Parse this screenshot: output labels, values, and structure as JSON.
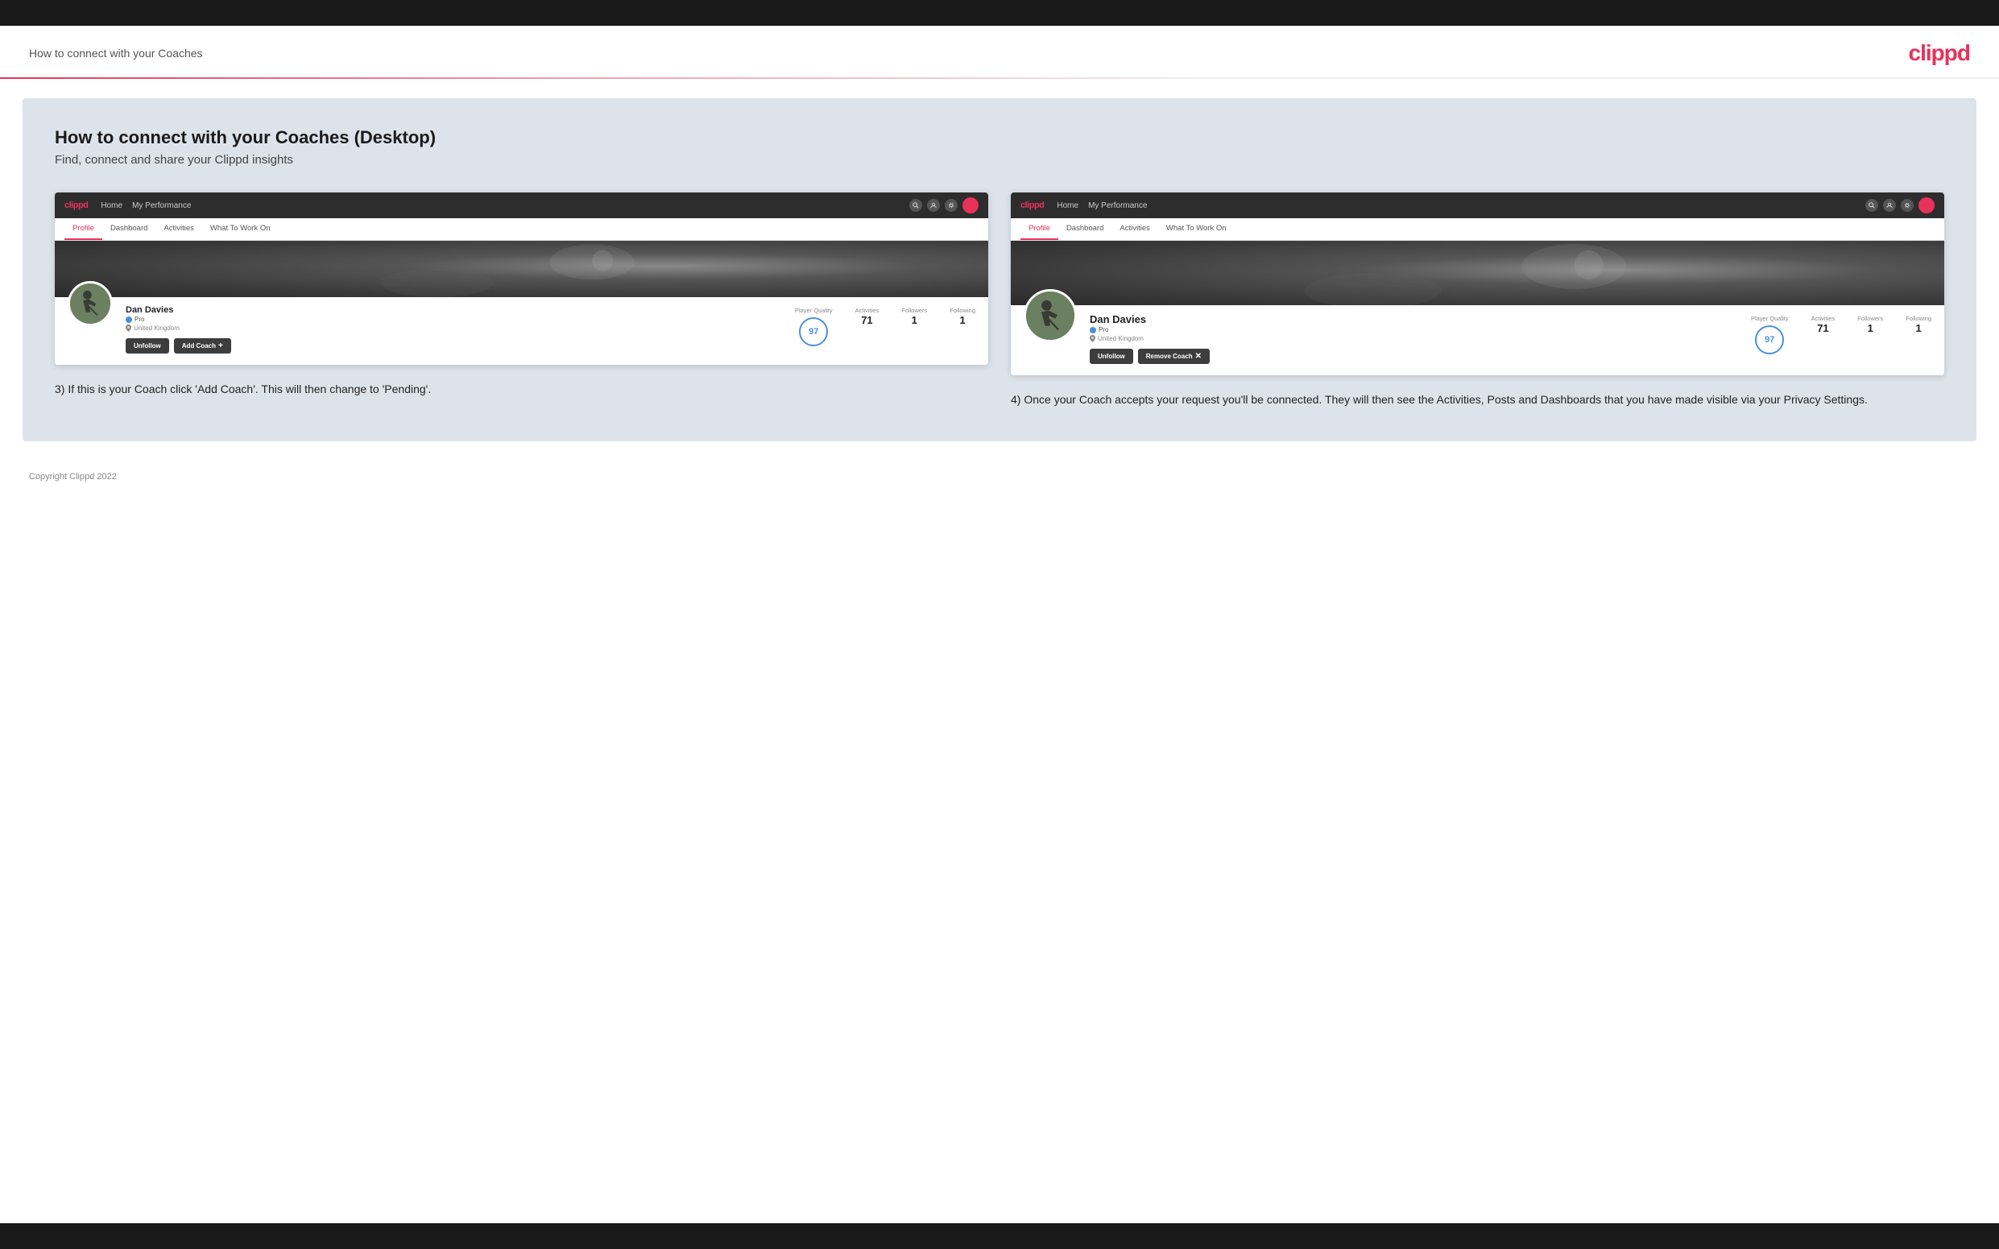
{
  "topBar": {},
  "header": {
    "title": "How to connect with your Coaches",
    "logo": "clippd"
  },
  "main": {
    "heading": "How to connect with your Coaches (Desktop)",
    "subheading": "Find, connect and share your Clippd insights",
    "sections": [
      {
        "id": "step3",
        "nav": {
          "logo": "clippd",
          "links": [
            "Home",
            "My Performance"
          ],
          "tabs": [
            "Profile",
            "Dashboard",
            "Activities",
            "What To Work On"
          ],
          "activeTab": "Profile"
        },
        "profile": {
          "name": "Dan Davies",
          "badge": "Pro",
          "location": "United Kingdom",
          "playerQuality": "97",
          "activities": "71",
          "followers": "1",
          "following": "1",
          "buttons": [
            "Unfollow",
            "Add Coach +"
          ]
        },
        "stats": {
          "playerQualityLabel": "Player Quality",
          "activitiesLabel": "Activities",
          "followersLabel": "Followers",
          "followingLabel": "Following"
        },
        "description": "3) If this is your Coach click 'Add Coach'. This will then change to 'Pending'."
      },
      {
        "id": "step4",
        "nav": {
          "logo": "clippd",
          "links": [
            "Home",
            "My Performance"
          ],
          "tabs": [
            "Profile",
            "Dashboard",
            "Activities",
            "What To Work On"
          ],
          "activeTab": "Profile"
        },
        "profile": {
          "name": "Dan Davies",
          "badge": "Pro",
          "location": "United Kingdom",
          "playerQuality": "97",
          "activities": "71",
          "followers": "1",
          "following": "1",
          "buttons": [
            "Unfollow",
            "Remove Coach ×"
          ]
        },
        "stats": {
          "playerQualityLabel": "Player Quality",
          "activitiesLabel": "Activities",
          "followersLabel": "Followers",
          "followingLabel": "Following"
        },
        "description": "4) Once your Coach accepts your request you'll be connected. They will then see the Activities, Posts and Dashboards that you have made visible via your Privacy Settings."
      }
    ]
  },
  "footer": {
    "copyright": "Copyright Clippd 2022"
  }
}
